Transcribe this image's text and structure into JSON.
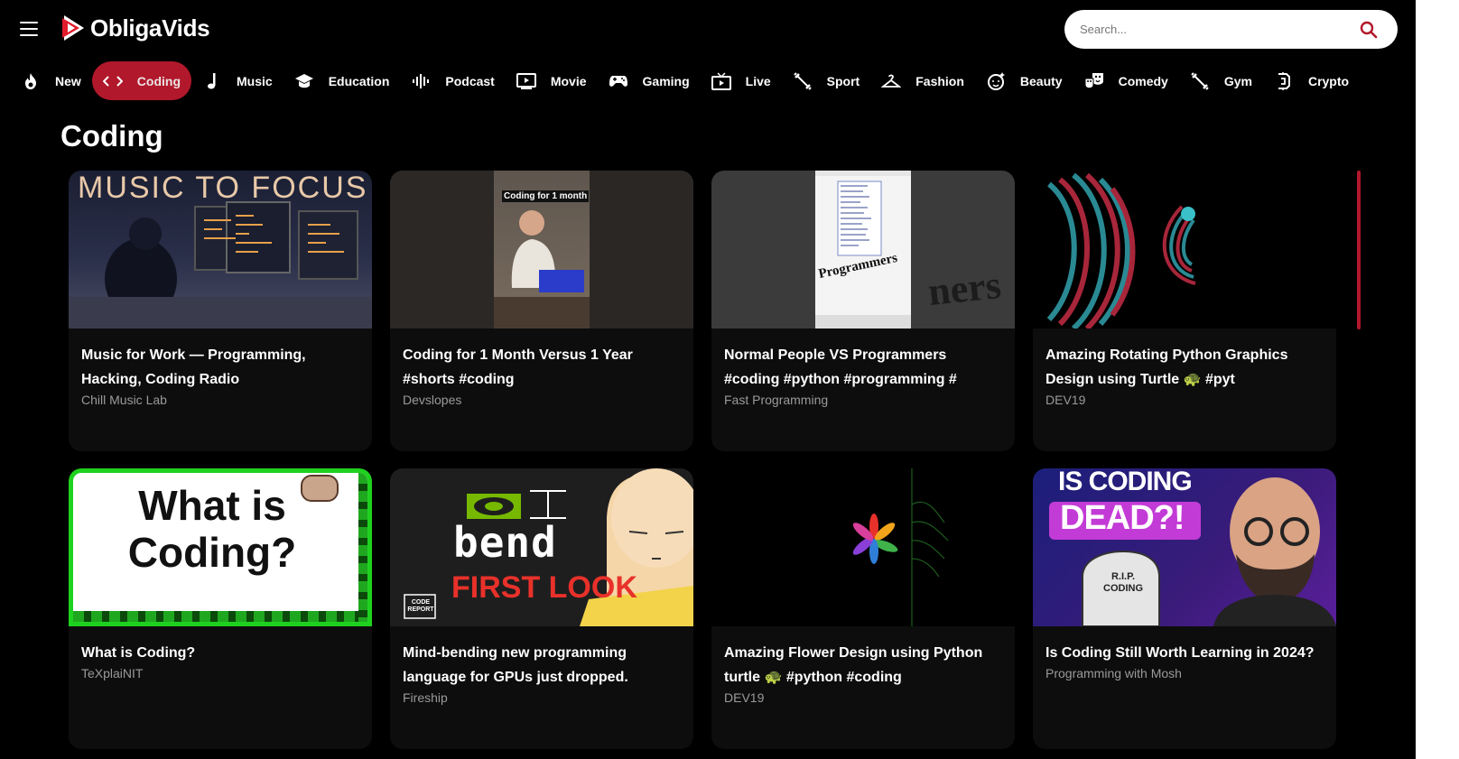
{
  "app": {
    "name": "ObligaVids"
  },
  "search": {
    "placeholder": "Search..."
  },
  "categories": [
    {
      "label": "New",
      "icon": "fire-icon",
      "active": false
    },
    {
      "label": "Coding",
      "icon": "code-icon",
      "active": true
    },
    {
      "label": "Music",
      "icon": "music-note-icon",
      "active": false
    },
    {
      "label": "Education",
      "icon": "graduation-cap-icon",
      "active": false
    },
    {
      "label": "Podcast",
      "icon": "audio-wave-icon",
      "active": false
    },
    {
      "label": "Movie",
      "icon": "play-screen-icon",
      "active": false
    },
    {
      "label": "Gaming",
      "icon": "gamepad-icon",
      "active": false
    },
    {
      "label": "Live",
      "icon": "tv-icon",
      "active": false
    },
    {
      "label": "Sport",
      "icon": "dumbbell-icon",
      "active": false
    },
    {
      "label": "Fashion",
      "icon": "hanger-icon",
      "active": false
    },
    {
      "label": "Beauty",
      "icon": "face-sparkle-icon",
      "active": false
    },
    {
      "label": "Comedy",
      "icon": "masks-icon",
      "active": false
    },
    {
      "label": "Gym",
      "icon": "dumbbell-icon",
      "active": false
    },
    {
      "label": "Crypto",
      "icon": "crypto-icon",
      "active": false
    }
  ],
  "section": {
    "title": "Coding"
  },
  "videos": [
    {
      "title": "Music for Work — Programming, Hacking, Coding Radio",
      "channel": "Chill Music Lab",
      "thumb_text": "MUSIC TO FOCUS"
    },
    {
      "title": "Coding for 1 Month Versus 1 Year #shorts #coding",
      "channel": "Devslopes",
      "thumb_text": "Coding for 1 month"
    },
    {
      "title": "Normal People VS Programmers #coding #python #programming #",
      "channel": "Fast Programming",
      "thumb_text": "Programmers"
    },
    {
      "title": "Amazing Rotating Python Graphics Design using Turtle 🐢 #pyt",
      "channel": "DEV19",
      "thumb_text": ""
    },
    {
      "title": "What is Coding?",
      "channel": "TeXplaiNIT",
      "thumb_text": "What is Coding?"
    },
    {
      "title": "Mind-bending new programming language for GPUs just dropped.",
      "channel": "Fireship",
      "thumb_text": "bend",
      "thumb_sub": "FIRST LOOK",
      "thumb_badge": "CODE REPORT"
    },
    {
      "title": "Amazing Flower Design using Python turtle 🐢 #python #coding",
      "channel": "DEV19",
      "thumb_text": ""
    },
    {
      "title": "Is Coding Still Worth Learning in 2024?",
      "channel": "Programming with Mosh",
      "thumb_text": "IS CODING",
      "thumb_sub": "DEAD?!",
      "thumb_badge": "R.I.P. CODING"
    }
  ],
  "colors": {
    "accent": "#b2182b",
    "background": "#000000",
    "muted_text": "#9a9a9a"
  }
}
